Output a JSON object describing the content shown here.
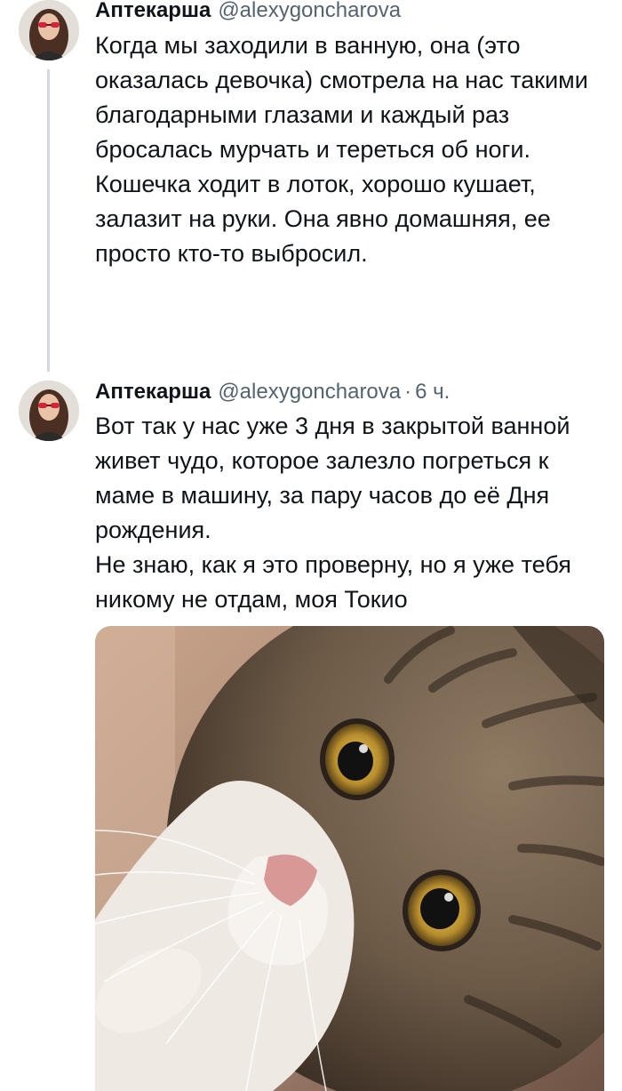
{
  "tweets": [
    {
      "author": "Аптекарша",
      "handle": "@alexygoncharova",
      "time": "",
      "text": [
        "Когда мы заходили в ванную, она (это оказалась девочка) смотрела на нас такими благодарными глазами и каждый раз бросалась мурчать и тереться об ноги. Кошечка ходит в лоток, хорошо кушает, залазит на руки. Она явно домашняя, ее просто кто-то выбросил."
      ]
    },
    {
      "author": "Аптекарша",
      "handle": "@alexygoncharova",
      "separator": "·",
      "time": "6 ч.",
      "text": [
        "Вот так у нас уже 3 дня в закрытой ванной живет чудо, которое залезло погреться к маме в машину, за пару часов до её Дня рождения.",
        "Не знаю, как я это проверну, но я уже тебя никому не отдам, моя Токио"
      ],
      "media": {
        "subject": "tabby-white-kitten-photo"
      }
    }
  ],
  "colors": {
    "text": "#0f1419",
    "secondary": "#536471",
    "thread_line": "#cfd9de"
  }
}
